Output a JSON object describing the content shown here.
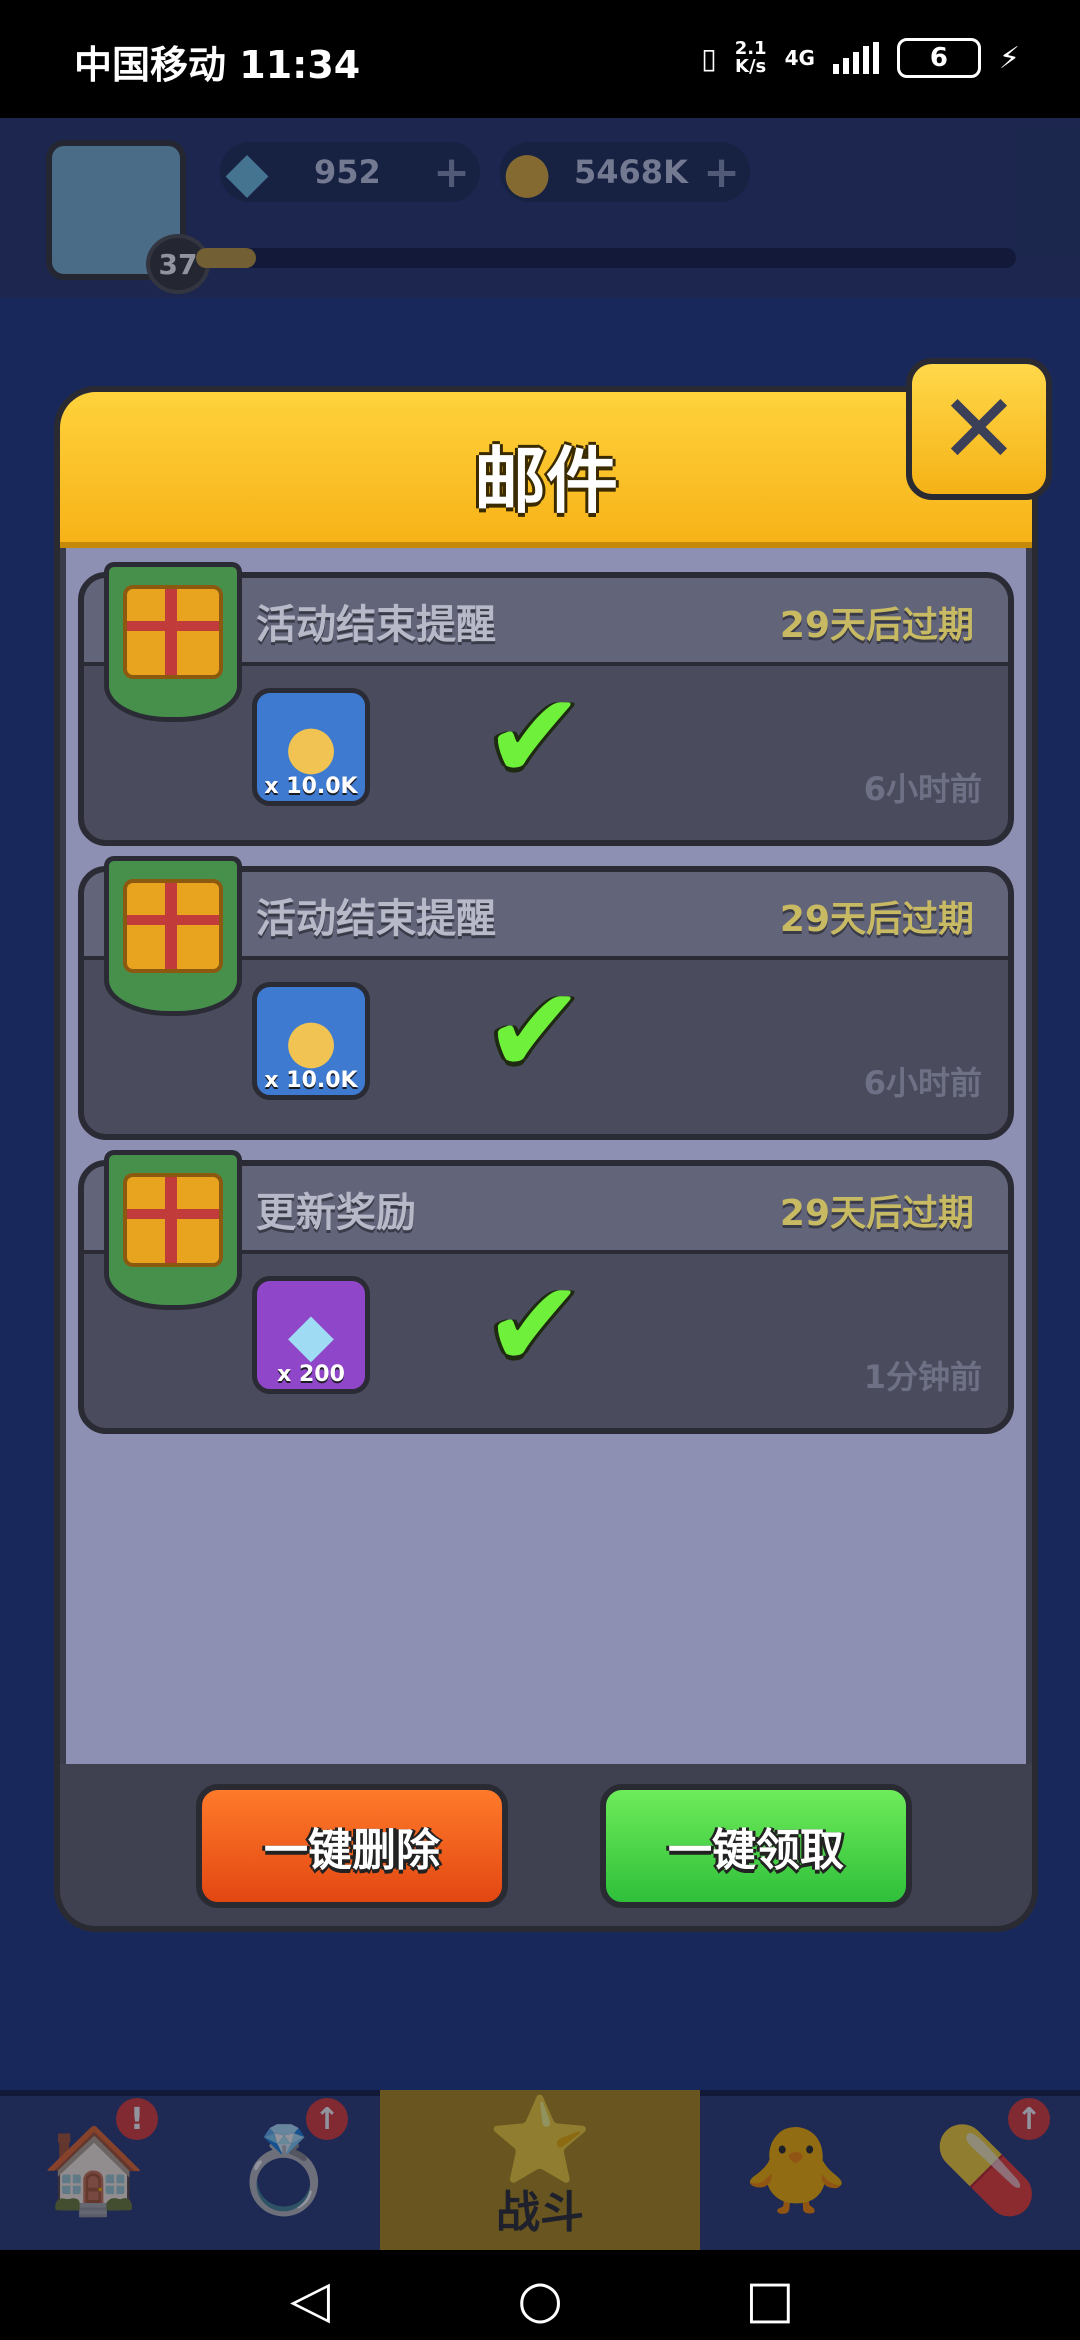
{
  "status_bar": {
    "carrier": "中国移动",
    "time": "11:34",
    "speed_top": "2.1",
    "speed_bottom": "K/s",
    "network": "4G",
    "battery": "6"
  },
  "header": {
    "level": "37",
    "gems": "952",
    "coins": "5468K"
  },
  "modal": {
    "title": "邮件",
    "mails": [
      {
        "title": "活动结束提醒",
        "expire": "29天后过期",
        "time": "6小时前",
        "reward_type": "coin",
        "reward_qty": "x 10.0K",
        "claimed": true
      },
      {
        "title": "活动结束提醒",
        "expire": "29天后过期",
        "time": "6小时前",
        "reward_type": "coin",
        "reward_qty": "x 10.0K",
        "claimed": true
      },
      {
        "title": "更新奖励",
        "expire": "29天后过期",
        "time": "1分钟前",
        "reward_type": "gem",
        "reward_qty": "x 200",
        "claimed": true
      }
    ],
    "delete_all_label": "一键删除",
    "claim_all_label": "一键领取"
  },
  "bottom_nav": {
    "battle_label": "战斗"
  },
  "colors": {
    "header_yellow": "#f7b318",
    "delete_orange": "#e24712",
    "claim_green": "#2fbf3a",
    "check_green": "#6ff03a"
  }
}
